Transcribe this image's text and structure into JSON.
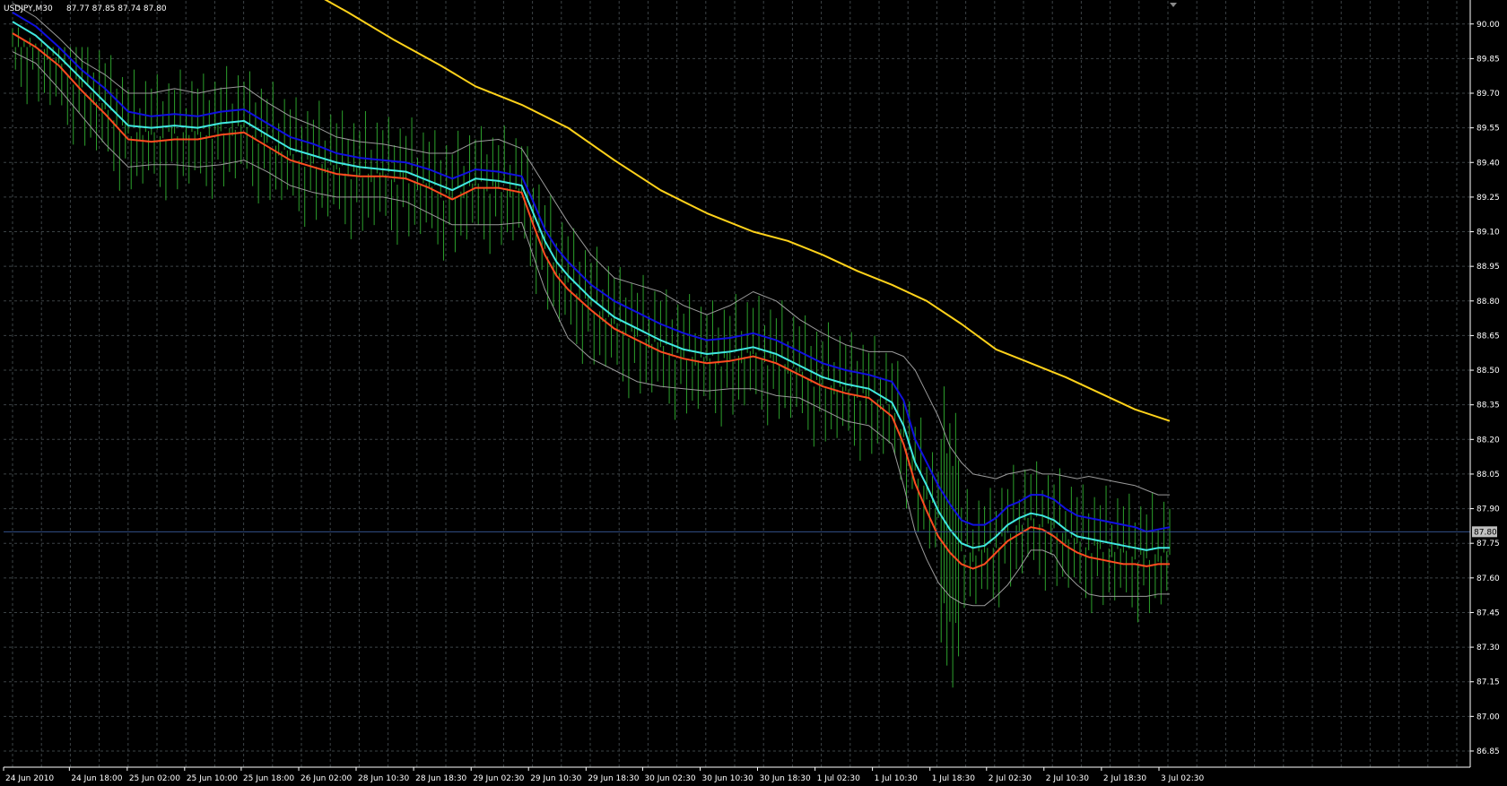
{
  "header": {
    "symbol": "USDJPY,M30",
    "ohlc": "87.77 87.85 87.74 87.80"
  },
  "current_price": {
    "label": "87.80",
    "value": 87.8
  },
  "colors": {
    "background": "#000000",
    "grid": "#3c4346",
    "axis": "#ffffff",
    "bars": "#2ca02c",
    "ma_blue": "#1010e0",
    "ma_cyan": "#40e8e0",
    "ma_red": "#ff4c20",
    "envelope": "#9a9a9a",
    "ma_yellow": "#ffd21a",
    "current_line": "#33508a",
    "current_box": "#c0c0c0"
  },
  "chart_data": {
    "type": "line",
    "title": "USDJPY,M30",
    "ylim": [
      86.78,
      90.1
    ],
    "xlim": [
      0,
      100
    ],
    "y_ticks": [
      "90.00",
      "89.85",
      "89.70",
      "89.55",
      "89.40",
      "89.25",
      "89.10",
      "88.95",
      "88.80",
      "88.65",
      "88.50",
      "88.35",
      "88.20",
      "88.05",
      "87.90",
      "87.75",
      "87.60",
      "87.45",
      "87.30",
      "87.15",
      "87.00",
      "86.85"
    ],
    "x_ticks": [
      {
        "label": "24 Jun 2010",
        "x": 0
      },
      {
        "label": "24 Jun 18:00",
        "x": 4.91
      },
      {
        "label": "25 Jun 02:00",
        "x": 9.91
      },
      {
        "label": "25 Jun 10:00",
        "x": 14.87
      },
      {
        "label": "25 Jun 18:00",
        "x": 19.76
      },
      {
        "label": "26 Jun 02:00",
        "x": 24.73
      },
      {
        "label": "28 Jun 10:30",
        "x": 29.69
      },
      {
        "label": "28 Jun 18:30",
        "x": 34.66
      },
      {
        "label": "29 Jun 02:30",
        "x": 39.63
      },
      {
        "label": "29 Jun 10:30",
        "x": 44.59
      },
      {
        "label": "29 Jun 18:30",
        "x": 49.56
      },
      {
        "label": "30 Jun 02:30",
        "x": 54.45
      },
      {
        "label": "30 Jun 10:30",
        "x": 59.42
      },
      {
        "label": "30 Jun 18:30",
        "x": 64.38
      },
      {
        "label": "1 Jul 02:30",
        "x": 69.35
      },
      {
        "label": "1 Jul 10:30",
        "x": 74.31
      },
      {
        "label": "1 Jul 18:30",
        "x": 79.28
      },
      {
        "label": "2 Jul 02:30",
        "x": 84.17
      },
      {
        "label": "2 Jul 10:30",
        "x": 89.13
      },
      {
        "label": "2 Jul 18:30",
        "x": 94.1
      },
      {
        "label": "3 Jul 02:30",
        "x": 99.07
      }
    ],
    "grid": true,
    "series": [
      {
        "key": "ma_yellow",
        "color": "#ffd21a",
        "x": [
          25.8,
          29,
          33,
          37,
          40,
          44,
          48,
          52,
          56,
          60,
          64,
          67,
          70,
          73,
          76,
          79,
          82,
          85,
          88,
          91,
          94,
          97,
          100
        ],
        "y": [
          90.14,
          90.05,
          89.93,
          89.82,
          89.73,
          89.65,
          89.55,
          89.41,
          89.28,
          89.18,
          89.1,
          89.06,
          89.0,
          88.93,
          88.87,
          88.8,
          88.7,
          88.59,
          88.53,
          88.47,
          88.4,
          88.33,
          88.28
        ]
      },
      {
        "key": "ma_blue",
        "color": "#1010e0",
        "x": [
          0,
          2,
          4,
          6,
          8,
          10,
          12,
          14,
          16,
          18,
          20,
          22,
          24,
          26,
          28,
          30,
          32,
          34,
          36,
          38,
          40,
          42,
          44,
          45,
          46,
          47,
          48,
          50,
          52,
          54,
          56,
          58,
          60,
          62,
          64,
          66,
          68,
          70,
          72,
          74,
          76,
          77,
          78,
          79,
          80,
          81,
          82,
          83,
          84,
          85,
          86,
          87,
          88,
          89,
          90,
          91,
          92,
          93,
          94,
          95,
          96,
          97,
          98,
          99,
          100
        ],
        "y": [
          90.05,
          89.99,
          89.9,
          89.8,
          89.72,
          89.62,
          89.6,
          89.61,
          89.6,
          89.62,
          89.63,
          89.57,
          89.51,
          89.48,
          89.44,
          89.42,
          89.41,
          89.4,
          89.37,
          89.33,
          89.37,
          89.36,
          89.34,
          89.23,
          89.11,
          89.03,
          88.97,
          88.87,
          88.8,
          88.75,
          88.7,
          88.66,
          88.63,
          88.64,
          88.66,
          88.63,
          88.58,
          88.53,
          88.5,
          88.48,
          88.45,
          88.37,
          88.2,
          88.1,
          88.0,
          87.92,
          87.85,
          87.83,
          87.83,
          87.86,
          87.91,
          87.93,
          87.96,
          87.96,
          87.94,
          87.9,
          87.87,
          87.86,
          87.85,
          87.84,
          87.83,
          87.82,
          87.8,
          87.81,
          87.82
        ]
      },
      {
        "key": "ma_cyan",
        "color": "#40e8e0",
        "x": [
          0,
          2,
          4,
          6,
          8,
          10,
          12,
          14,
          16,
          18,
          20,
          22,
          24,
          26,
          28,
          30,
          32,
          34,
          36,
          38,
          40,
          42,
          44,
          45,
          46,
          47,
          48,
          50,
          52,
          54,
          56,
          58,
          60,
          62,
          64,
          66,
          68,
          70,
          72,
          74,
          76,
          77,
          78,
          79,
          80,
          81,
          82,
          83,
          84,
          85,
          86,
          87,
          88,
          89,
          90,
          91,
          92,
          93,
          94,
          95,
          96,
          97,
          98,
          99,
          100
        ],
        "y": [
          90.01,
          89.95,
          89.86,
          89.76,
          89.66,
          89.56,
          89.55,
          89.56,
          89.55,
          89.57,
          89.58,
          89.52,
          89.46,
          89.43,
          89.4,
          89.38,
          89.37,
          89.36,
          89.32,
          89.28,
          89.33,
          89.32,
          89.3,
          89.18,
          89.06,
          88.97,
          88.91,
          88.81,
          88.73,
          88.68,
          88.63,
          88.59,
          88.57,
          88.58,
          88.6,
          88.57,
          88.52,
          88.47,
          88.44,
          88.42,
          88.36,
          88.26,
          88.1,
          88.0,
          87.89,
          87.81,
          87.75,
          87.73,
          87.74,
          87.78,
          87.83,
          87.86,
          87.88,
          87.87,
          87.85,
          87.81,
          87.78,
          87.77,
          87.76,
          87.75,
          87.74,
          87.73,
          87.72,
          87.73,
          87.73
        ]
      },
      {
        "key": "ma_red",
        "color": "#ff4c20",
        "x": [
          0,
          2,
          4,
          6,
          8,
          10,
          12,
          14,
          16,
          18,
          20,
          22,
          24,
          26,
          28,
          30,
          32,
          34,
          36,
          38,
          40,
          42,
          44,
          45,
          46,
          47,
          48,
          50,
          52,
          54,
          56,
          58,
          60,
          62,
          64,
          66,
          68,
          70,
          72,
          74,
          76,
          77,
          78,
          79,
          80,
          81,
          82,
          83,
          84,
          85,
          86,
          87,
          88,
          89,
          90,
          91,
          92,
          93,
          94,
          95,
          96,
          97,
          98,
          99,
          100
        ],
        "y": [
          89.96,
          89.9,
          89.82,
          89.71,
          89.61,
          89.5,
          89.49,
          89.5,
          89.5,
          89.52,
          89.53,
          89.47,
          89.41,
          89.38,
          89.35,
          89.34,
          89.34,
          89.33,
          89.29,
          89.24,
          89.29,
          89.29,
          89.27,
          89.13,
          89.0,
          88.91,
          88.85,
          88.76,
          88.68,
          88.63,
          88.58,
          88.55,
          88.53,
          88.54,
          88.56,
          88.53,
          88.48,
          88.43,
          88.4,
          88.38,
          88.3,
          88.18,
          88.01,
          87.89,
          87.78,
          87.71,
          87.66,
          87.64,
          87.66,
          87.71,
          87.76,
          87.79,
          87.82,
          87.81,
          87.78,
          87.74,
          87.71,
          87.69,
          87.68,
          87.67,
          87.66,
          87.66,
          87.65,
          87.66,
          87.66
        ]
      },
      {
        "key": "env_upper",
        "color": "#9a9a9a",
        "x": [
          0,
          2,
          4,
          6,
          8,
          10,
          12,
          14,
          16,
          18,
          20,
          22,
          24,
          26,
          28,
          30,
          32,
          34,
          36,
          38,
          40,
          42,
          44,
          46,
          48,
          50,
          52,
          54,
          56,
          58,
          60,
          62,
          64,
          66,
          68,
          70,
          72,
          74,
          76,
          77,
          78,
          79,
          80,
          81,
          82,
          83,
          84,
          85,
          86,
          87,
          88,
          89,
          90,
          91,
          92,
          93,
          94,
          95,
          96,
          97,
          98,
          99,
          100
        ],
        "y": [
          90.09,
          90.03,
          89.94,
          89.84,
          89.78,
          89.7,
          89.7,
          89.72,
          89.7,
          89.72,
          89.73,
          89.66,
          89.6,
          89.56,
          89.51,
          89.49,
          89.48,
          89.46,
          89.44,
          89.44,
          89.49,
          89.5,
          89.46,
          89.3,
          89.14,
          89.0,
          88.9,
          88.87,
          88.84,
          88.78,
          88.74,
          88.78,
          88.84,
          88.8,
          88.72,
          88.66,
          88.61,
          88.58,
          88.58,
          88.56,
          88.5,
          88.4,
          88.3,
          88.17,
          88.1,
          88.05,
          88.04,
          88.03,
          88.05,
          88.06,
          88.07,
          88.05,
          88.05,
          88.04,
          88.03,
          88.04,
          88.03,
          88.02,
          88.01,
          88.0,
          87.98,
          87.96,
          87.96
        ]
      },
      {
        "key": "env_lower",
        "color": "#9a9a9a",
        "x": [
          0,
          2,
          4,
          6,
          8,
          10,
          12,
          14,
          16,
          18,
          20,
          22,
          24,
          26,
          28,
          30,
          32,
          34,
          36,
          38,
          40,
          42,
          44,
          46,
          48,
          50,
          52,
          54,
          56,
          58,
          60,
          62,
          64,
          66,
          68,
          70,
          72,
          74,
          76,
          77,
          78,
          79,
          80,
          81,
          82,
          83,
          84,
          85,
          86,
          87,
          88,
          89,
          90,
          91,
          92,
          93,
          94,
          95,
          96,
          97,
          98,
          99,
          100
        ],
        "y": [
          89.88,
          89.83,
          89.72,
          89.6,
          89.48,
          89.38,
          89.39,
          89.39,
          89.38,
          89.39,
          89.41,
          89.36,
          89.3,
          89.27,
          89.25,
          89.25,
          89.25,
          89.23,
          89.18,
          89.13,
          89.13,
          89.13,
          89.14,
          88.85,
          88.64,
          88.55,
          88.5,
          88.45,
          88.43,
          88.42,
          88.41,
          88.42,
          88.42,
          88.39,
          88.38,
          88.33,
          88.28,
          88.26,
          88.18,
          88.0,
          87.8,
          87.68,
          87.58,
          87.52,
          87.49,
          87.48,
          87.48,
          87.52,
          87.57,
          87.64,
          87.72,
          87.72,
          87.7,
          87.62,
          87.57,
          87.53,
          87.52,
          87.52,
          87.52,
          87.52,
          87.52,
          87.53,
          87.53
        ]
      }
    ]
  }
}
